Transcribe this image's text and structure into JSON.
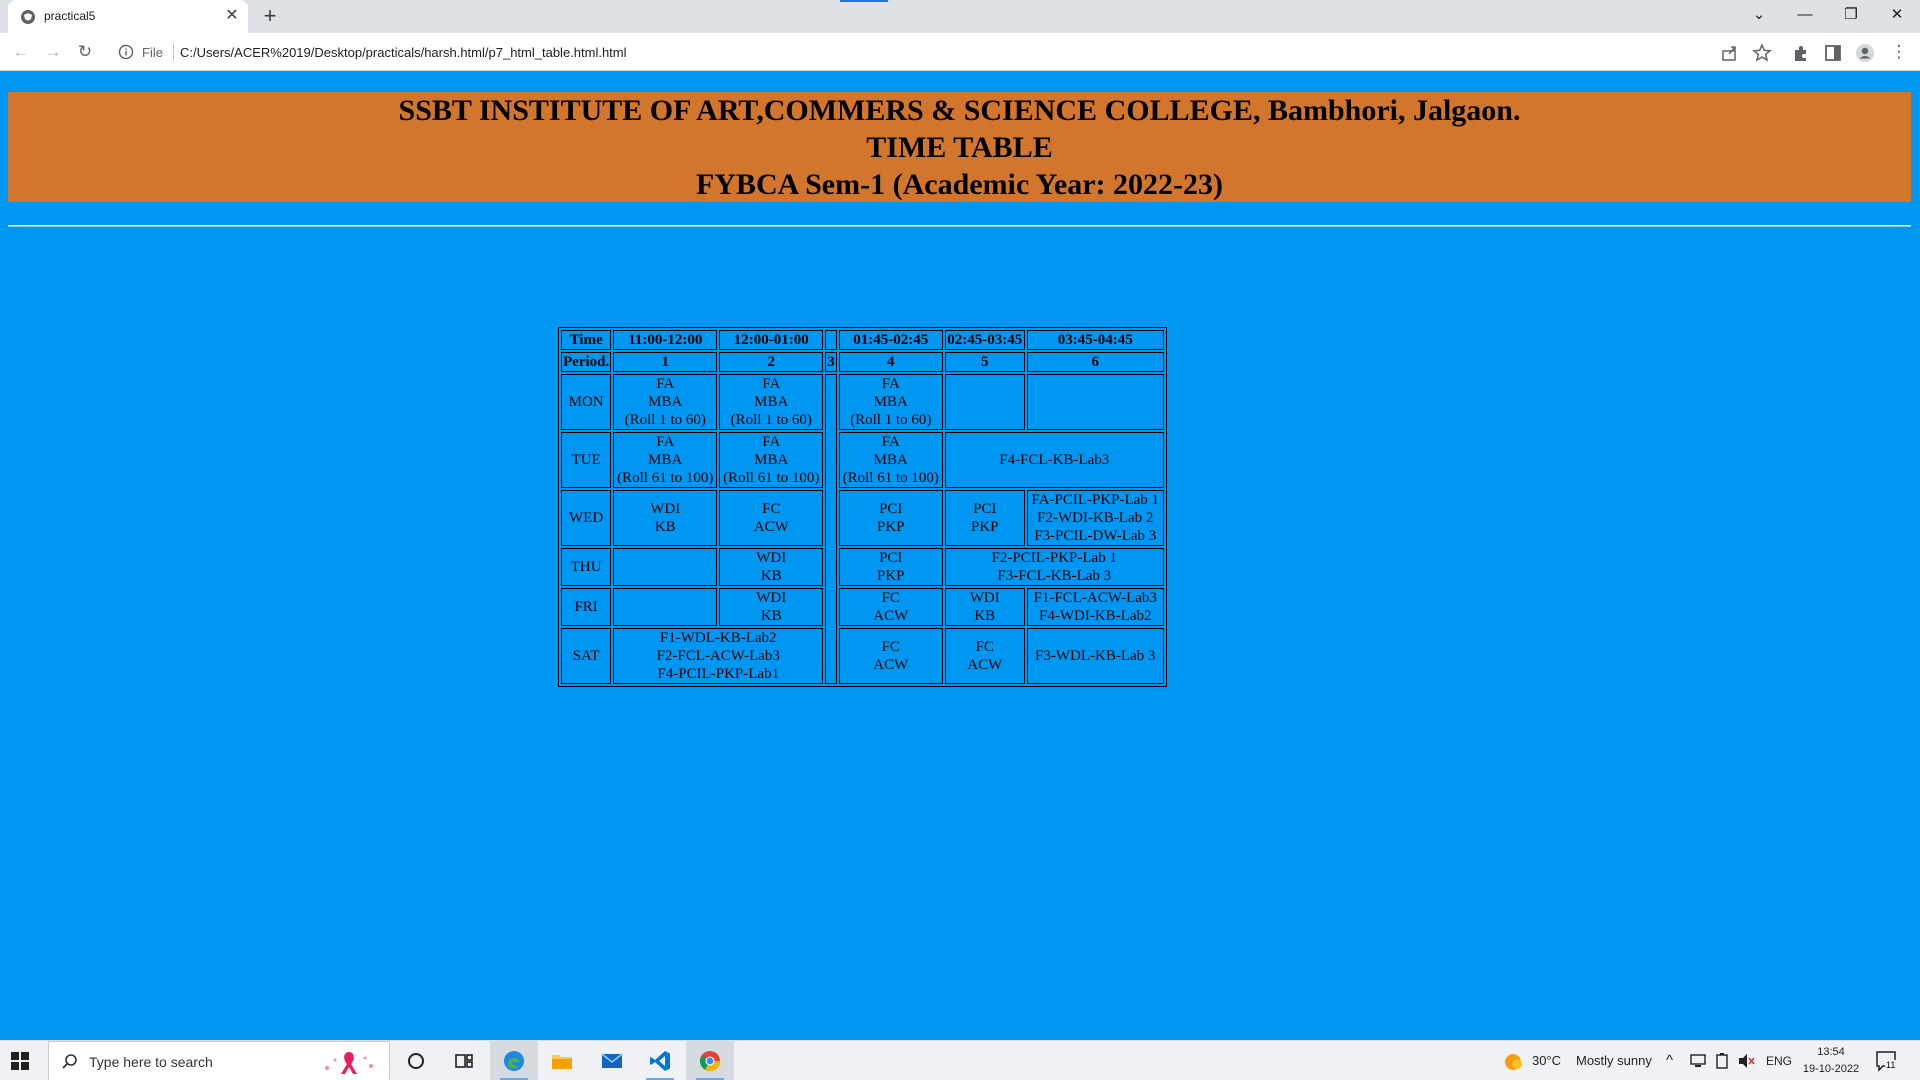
{
  "browser": {
    "tab_title": "practical5",
    "address_scheme": "File",
    "url": "C:/Users/ACER%2019/Desktop/practicals/harsh.html/p7_html_table.html.html"
  },
  "header": {
    "line1": "SSBT INSTITUTE OF ART,COMMERS & SCIENCE COLLEGE, Bambhori, Jalgaon.",
    "line2": "TIME TABLE",
    "line3": "FYBCA Sem-1 (Academic Year: 2022-23)"
  },
  "timetable": {
    "time_label": "Time",
    "period_label": "Period.",
    "times": [
      "11:00-12:00",
      "12:00-01:00",
      "",
      "01:45-02:45",
      "02:45-03:45",
      "03:45-04:45"
    ],
    "periods": [
      "1",
      "2",
      "3",
      "4",
      "5",
      "6"
    ],
    "mon": {
      "day": "MON",
      "p1": [
        "FA",
        "MBA",
        "(Roll 1 to 60)"
      ],
      "p2": [
        "FA",
        "MBA",
        "(Roll 1 to 60)"
      ],
      "p4": [
        "FA",
        "MBA",
        "(Roll 1 to 60)"
      ]
    },
    "tue": {
      "day": "TUE",
      "p1": [
        "FA",
        "MBA",
        "(Roll 61 to 100)"
      ],
      "p2": [
        "FA",
        "MBA",
        "(Roll 61 to 100)"
      ],
      "p4": [
        "FA",
        "MBA",
        "(Roll 61 to 100)"
      ],
      "p56": "F4-FCL-KB-Lab3"
    },
    "wed": {
      "day": "WED",
      "p1": [
        "WDI",
        "KB"
      ],
      "p2": [
        "FC",
        "ACW"
      ],
      "p4": [
        "PCI",
        "PKP"
      ],
      "p5": [
        "PCI",
        "PKP"
      ],
      "p6": [
        "FA-PCIL-PKP-Lab 1",
        "F2-WDI-KB-Lab 2",
        "F3-PCIL-DW-Lab 3"
      ]
    },
    "thu": {
      "day": "THU",
      "p2": [
        "WDI",
        "KB"
      ],
      "p4": [
        "PCI",
        "PKP"
      ],
      "p56": [
        "F2-PCIL-PKP-Lab 1",
        "F3-FCL-KB-Lab 3"
      ]
    },
    "fri": {
      "day": "FRI",
      "p2": [
        "WDI",
        "KB"
      ],
      "p4": [
        "FC",
        "ACW"
      ],
      "p5": [
        "WDI",
        "KB"
      ],
      "p6": [
        "F1-FCL-ACW-Lab3",
        "F4-WDI-KB-Lab2"
      ]
    },
    "sat": {
      "day": "SAT",
      "p12": [
        "F1-WDL-KB-Lab2",
        "F2-FCL-ACW-Lab3",
        "F4-PCIL-PKP-Lab1"
      ],
      "p4": [
        "FC",
        "ACW"
      ],
      "p5": [
        "FC",
        "ACW"
      ],
      "p6": "F3-WDL-KB-Lab 3"
    }
  },
  "taskbar": {
    "search_placeholder": "Type here to search",
    "weather_temp": "30°C",
    "weather_text": "Mostly sunny",
    "language": "ENG",
    "time": "13:54",
    "date": "19-10-2022",
    "notification_count": "11"
  },
  "colors": {
    "page_background": "#0097F2",
    "header_background": "#D2762D"
  }
}
